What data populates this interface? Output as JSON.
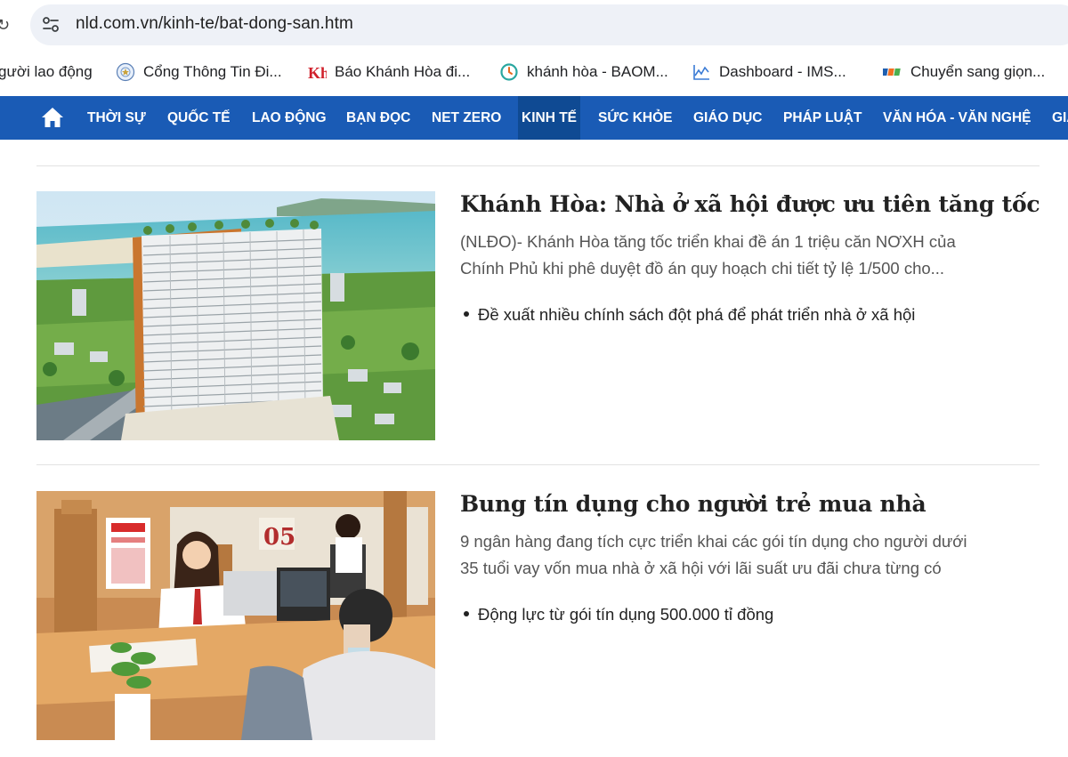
{
  "browser": {
    "url": "nld.com.vn/kinh-te/bat-dong-san.htm",
    "bookmarks": [
      {
        "label": "gười lao động",
        "icon": "none"
      },
      {
        "label": "Cổng Thông Tin Đi...",
        "icon": "government-emblem-icon"
      },
      {
        "label": "Báo Khánh Hòa đi...",
        "icon": "kh-logo-icon"
      },
      {
        "label": "khánh hòa - BAOM...",
        "icon": "clock-circle-icon"
      },
      {
        "label": "Dashboard - IMS...",
        "icon": "chart-line-icon"
      },
      {
        "label": "Chuyển sang giọn...",
        "icon": "fpt-logo-icon"
      }
    ]
  },
  "nav": {
    "items": [
      {
        "label": "THỜI SỰ"
      },
      {
        "label": "QUỐC TẾ"
      },
      {
        "label": "LAO ĐỘNG"
      },
      {
        "label": "BẠN ĐỌC"
      },
      {
        "label": "NET ZERO"
      },
      {
        "label": "KINH TẾ",
        "active": true
      },
      {
        "label": "SỨC KHỎE"
      },
      {
        "label": "GIÁO DỤC"
      },
      {
        "label": "PHÁP LUẬT"
      },
      {
        "label": "VĂN HÓA - VĂN NGHỆ"
      },
      {
        "label": "GIẢ"
      }
    ],
    "colors": {
      "bar": "#1a5bb5",
      "active": "#0f4a93"
    }
  },
  "articles": [
    {
      "title": "Khánh Hòa: Nhà ở xã hội được ưu tiên tăng tốc",
      "sapo_line1": "(NLĐO)- Khánh Hòa tăng tốc triển khai đề án 1 triệu căn NƠXH của",
      "sapo_line2": "Chính Phủ khi phê duyệt đồ án quy hoạch chi tiết tỷ lệ 1/500 cho...",
      "related": "Đề xuất nhiều chính sách đột phá để phát triển nhà ở xã hội"
    },
    {
      "title": "Bung tín dụng cho người trẻ mua nhà",
      "sapo_line1": "9 ngân hàng đang tích cực triển khai các gói tín dụng cho người dưới",
      "sapo_line2": "35 tuổi vay vốn mua nhà ở xã hội với lãi suất ưu đãi chưa từng có",
      "related": "Động lực từ gói tín dụng 500.000 tỉ đồng",
      "counter_sign": "05"
    }
  ]
}
